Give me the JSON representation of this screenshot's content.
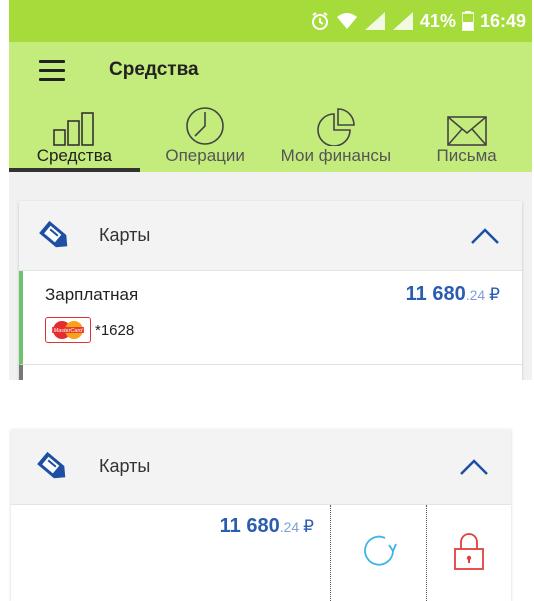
{
  "status": {
    "battery_percent": "41%",
    "time": "16:49",
    "icons": [
      "alarm-icon",
      "wifi-icon",
      "signal-icon",
      "signal-icon",
      "battery-icon"
    ]
  },
  "appbar": {
    "title": "Средства",
    "menu_icon": "hamburger-icon"
  },
  "tabs": [
    {
      "label": "Средства",
      "icon": "bar-chart-icon",
      "active": true
    },
    {
      "label": "Операции",
      "icon": "clock-icon",
      "active": false
    },
    {
      "label": "Мои финансы",
      "icon": "pie-chart-icon",
      "active": false
    },
    {
      "label": "Письма",
      "icon": "envelope-icon",
      "active": false
    }
  ],
  "cards_section": {
    "title": "Карты",
    "icon": "card-tag-icon",
    "items": [
      {
        "name": "Зарплатная",
        "amount_int": "11 680",
        "amount_cents": ".24",
        "currency": "₽",
        "card_brand": "MasterCard",
        "card_mask": "*1628"
      }
    ]
  },
  "cards_section_swiped": {
    "title": "Карты",
    "amount_int": "11 680",
    "amount_cents": ".24",
    "currency": "₽",
    "actions": [
      "refresh-icon",
      "lock-icon"
    ]
  },
  "colors": {
    "statusbar": "#a5dc3c",
    "appbar": "#c4ec7c",
    "amount": "#2a5db0",
    "accent_green": "#6cc36c",
    "refresh": "#3cb4e6",
    "lock": "#e0403c"
  }
}
